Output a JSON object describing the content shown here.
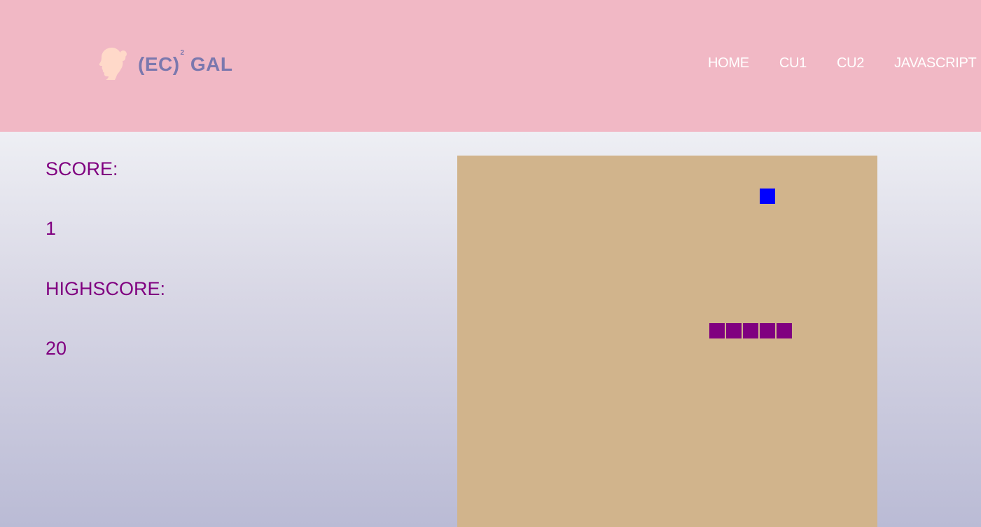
{
  "header": {
    "brand": {
      "main": "(EC)",
      "superscript": "2",
      "suffix": "GAL",
      "icon": "woman-silhouette-icon"
    },
    "nav": [
      "HOME",
      "CU1",
      "CU2",
      "JAVASCRIPT"
    ]
  },
  "game": {
    "score_label": "SCORE:",
    "score": "1",
    "highscore_label": "HIGHSCORE:",
    "highscore": "20",
    "grid": {
      "cell": 24
    },
    "food": {
      "col": 18,
      "row": 1
    },
    "snake": [
      {
        "col": 15,
        "row": 9
      },
      {
        "col": 16,
        "row": 9
      },
      {
        "col": 17,
        "row": 9
      },
      {
        "col": 18,
        "row": 9
      },
      {
        "col": 19,
        "row": 9
      }
    ]
  },
  "colors": {
    "header_bg": "#f1b8c5",
    "brand": "#7b78ae",
    "text": "#800080",
    "board_bg": "#d1b48c",
    "food": "#0000ff",
    "snake": "#800080"
  }
}
